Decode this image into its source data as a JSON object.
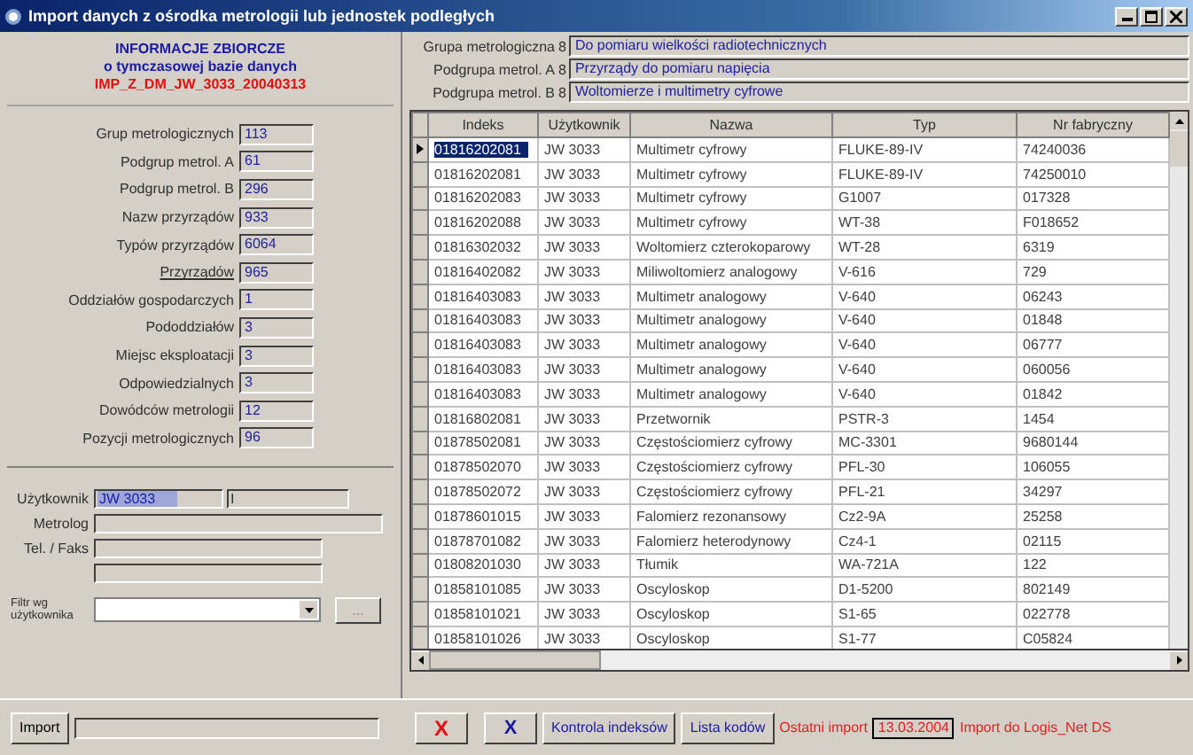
{
  "window": {
    "title": "Import danych z ośrodka metrologii lub jednostek podległych"
  },
  "summary": {
    "title": "INFORMACJE ZBIORCZE",
    "subtitle": "o tymczasowej bazie danych",
    "database": "IMP_Z_DM_JW_3033_20040313"
  },
  "stats": [
    {
      "label": "Grup metrologicznych",
      "value": "113",
      "kind": "plain"
    },
    {
      "label": "Podgrup metrol. A",
      "value": "61",
      "kind": "plain"
    },
    {
      "label": "Podgrup metrol. B",
      "value": "296",
      "kind": "plain"
    },
    {
      "label": "Nazw przyrządów",
      "value": "933",
      "kind": "plain"
    },
    {
      "label": "Typów przyrządów",
      "value": "6064",
      "kind": "plain"
    },
    {
      "label": "Przyrządów",
      "value": "965",
      "kind": "link"
    },
    {
      "label": "Oddziałów gospodarczych",
      "value": "1",
      "kind": "plain"
    },
    {
      "label": "Pododdziałów",
      "value": "3",
      "kind": "plain"
    },
    {
      "label": "Miejsc eksploatacji",
      "value": "3",
      "kind": "plain"
    },
    {
      "label": "Odpowiedzialnych",
      "value": "3",
      "kind": "plain"
    },
    {
      "label": "Dowódców metrologii",
      "value": "12",
      "kind": "plain"
    },
    {
      "label": "Pozycji metrologicznych",
      "value": "96",
      "kind": "plain"
    }
  ],
  "user": {
    "user_label": "Użytkownik",
    "user_value": "JW 3033",
    "user_extra": "I",
    "metrolog_label": "Metrolog",
    "phone_label": "Tel. / Faks",
    "filter_label": "Filtr wg użytkownika",
    "filter_button": "..."
  },
  "groups": [
    {
      "label": "Grupa metrologiczna",
      "code": "8",
      "value": "Do pomiaru wielkości radiotechnicznych"
    },
    {
      "label": "Podgrupa metrol. A",
      "code": "8",
      "value": "Przyrządy do pomiaru napięcia"
    },
    {
      "label": "Podgrupa metrol. B",
      "code": "8",
      "value": "Woltomierze i multimetry cyfrowe"
    }
  ],
  "table": {
    "columns": [
      "Indeks",
      "Użytkownik",
      "Nazwa",
      "Typ",
      "Nr fabryczny"
    ],
    "rows": [
      {
        "cells": [
          "01816202081",
          "JW 3033",
          "Multimetr cyfrowy",
          "FLUKE-89-IV",
          "74240036"
        ],
        "selected": true
      },
      {
        "cells": [
          "01816202081",
          "JW 3033",
          "Multimetr cyfrowy",
          "FLUKE-89-IV",
          "74250010"
        ],
        "selected": false
      },
      {
        "cells": [
          "01816202083",
          "JW 3033",
          "Multimetr cyfrowy",
          "G1007",
          "017328"
        ],
        "selected": false
      },
      {
        "cells": [
          "01816202088",
          "JW 3033",
          "Multimetr cyfrowy",
          "WT-38",
          "F018652"
        ],
        "selected": false
      },
      {
        "cells": [
          "01816302032",
          "JW 3033",
          "Woltomierz czterokoparowy",
          "WT-28",
          "6319"
        ],
        "selected": false
      },
      {
        "cells": [
          "01816402082",
          "JW 3033",
          "Miliwoltomierz analogowy",
          "V-616",
          "729"
        ],
        "selected": false
      },
      {
        "cells": [
          "01816403083",
          "JW 3033",
          "Multimetr analogowy",
          "V-640",
          "06243"
        ],
        "selected": false
      },
      {
        "cells": [
          "01816403083",
          "JW 3033",
          "Multimetr analogowy",
          "V-640",
          "01848"
        ],
        "selected": false
      },
      {
        "cells": [
          "01816403083",
          "JW 3033",
          "Multimetr analogowy",
          "V-640",
          "06777"
        ],
        "selected": false
      },
      {
        "cells": [
          "01816403083",
          "JW 3033",
          "Multimetr analogowy",
          "V-640",
          "060056"
        ],
        "selected": false
      },
      {
        "cells": [
          "01816403083",
          "JW 3033",
          "Multimetr analogowy",
          "V-640",
          "01842"
        ],
        "selected": false
      },
      {
        "cells": [
          "01816802081",
          "JW 3033",
          "Przetwornik",
          "PSTR-3",
          "1454"
        ],
        "selected": false
      },
      {
        "cells": [
          "01878502081",
          "JW 3033",
          "Częstościomierz cyfrowy",
          "MC-3301",
          "9680144"
        ],
        "selected": false
      },
      {
        "cells": [
          "01878502070",
          "JW 3033",
          "Częstościomierz cyfrowy",
          "PFL-30",
          "106055"
        ],
        "selected": false
      },
      {
        "cells": [
          "01878502072",
          "JW 3033",
          "Częstościomierz cyfrowy",
          "PFL-21",
          "34297"
        ],
        "selected": false
      },
      {
        "cells": [
          "01878601015",
          "JW 3033",
          "Falomierz rezonansowy",
          "Cz2-9A",
          "25258"
        ],
        "selected": false
      },
      {
        "cells": [
          "01878701082",
          "JW 3033",
          "Falomierz heterodynowy",
          "Cz4-1",
          "02115"
        ],
        "selected": false
      },
      {
        "cells": [
          "01808201030",
          "JW 3033",
          "Tłumik",
          "WA-721A",
          "122"
        ],
        "selected": false
      },
      {
        "cells": [
          "01858101085",
          "JW 3033",
          "Oscyloskop",
          "D1-5200",
          "802149"
        ],
        "selected": false
      },
      {
        "cells": [
          "01858101021",
          "JW 3033",
          "Oscyloskop",
          "S1-65",
          "022778"
        ],
        "selected": false
      },
      {
        "cells": [
          "01858101026",
          "JW 3033",
          "Oscyloskop",
          "S1-77",
          "C05824"
        ],
        "selected": false
      }
    ]
  },
  "footer": {
    "import_progress": {
      "level": 0
    },
    "import_button": "Import",
    "cancel_glyph": "X",
    "x_button": "X",
    "check_button": "Kontrola indeksów",
    "codes_button": "Lista kodów",
    "last_import_label": "Ostatni import",
    "last_import_date": "13.03.2004",
    "target_label": "Import do Logis_Net DS"
  }
}
